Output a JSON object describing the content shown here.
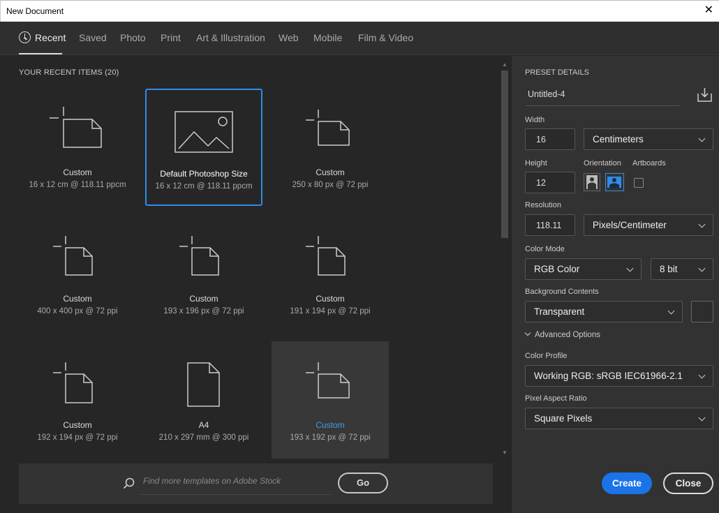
{
  "window": {
    "title": "New Document",
    "close_glyph": "✕"
  },
  "tabs": [
    {
      "label": "Recent",
      "active": true,
      "icon": "clock-icon"
    },
    {
      "label": "Saved"
    },
    {
      "label": "Photo"
    },
    {
      "label": "Print"
    },
    {
      "label": "Art & Illustration"
    },
    {
      "label": "Web"
    },
    {
      "label": "Mobile"
    },
    {
      "label": "Film & Video"
    }
  ],
  "recent": {
    "header": "YOUR RECENT ITEMS  (20)",
    "items": [
      {
        "name": "Custom",
        "dims": "16 x 12 cm @ 118.11 ppcm",
        "icon": "landscape-doc-icon"
      },
      {
        "name": "Default Photoshop Size",
        "dims": "16 x 12 cm @ 118.11 ppcm",
        "icon": "photo-icon",
        "state": "selected"
      },
      {
        "name": "Custom",
        "dims": "250 x 80 px @ 72 ppi",
        "icon": "landscape-doc-icon"
      },
      {
        "name": "Custom",
        "dims": "400 x 400 px @ 72 ppi",
        "icon": "portrait-doc-icon"
      },
      {
        "name": "Custom",
        "dims": "193 x 196 px @ 72 ppi",
        "icon": "portrait-doc-icon"
      },
      {
        "name": "Custom",
        "dims": "191 x 194 px @ 72 ppi",
        "icon": "portrait-doc-icon"
      },
      {
        "name": "Custom",
        "dims": "192 x 194 px @ 72 ppi",
        "icon": "portrait-doc-icon"
      },
      {
        "name": "A4",
        "dims": "210 x 297 mm @ 300 ppi",
        "icon": "page-icon"
      },
      {
        "name": "Custom",
        "dims": "193 x 192 px @ 72 ppi",
        "icon": "landscape-doc-icon",
        "state": "hover"
      }
    ]
  },
  "search": {
    "placeholder": "Find more templates on Adobe Stock",
    "value": "",
    "go_label": "Go"
  },
  "preset": {
    "header": "PRESET DETAILS",
    "doc_name": "Untitled-4",
    "width_label": "Width",
    "width_value": "16",
    "width_unit": "Centimeters",
    "height_label": "Height",
    "height_value": "12",
    "orientation_label": "Orientation",
    "orientation_selected": "landscape",
    "artboards_label": "Artboards",
    "artboards_checked": false,
    "resolution_label": "Resolution",
    "resolution_value": "118.11",
    "resolution_unit": "Pixels/Centimeter",
    "color_mode_label": "Color Mode",
    "color_mode": "RGB Color",
    "bit_depth": "8 bit",
    "background_label": "Background Contents",
    "background": "Transparent",
    "advanced_label": "Advanced Options",
    "color_profile_label": "Color Profile",
    "color_profile": "Working RGB: sRGB IEC61966-2.1",
    "pixel_aspect_label": "Pixel Aspect Ratio",
    "pixel_aspect": "Square Pixels"
  },
  "buttons": {
    "create": "Create",
    "close": "Close"
  },
  "colors": {
    "accent": "#1a73e8",
    "selected_border": "#2d8ceb",
    "hover_text": "#4a9ae8"
  }
}
